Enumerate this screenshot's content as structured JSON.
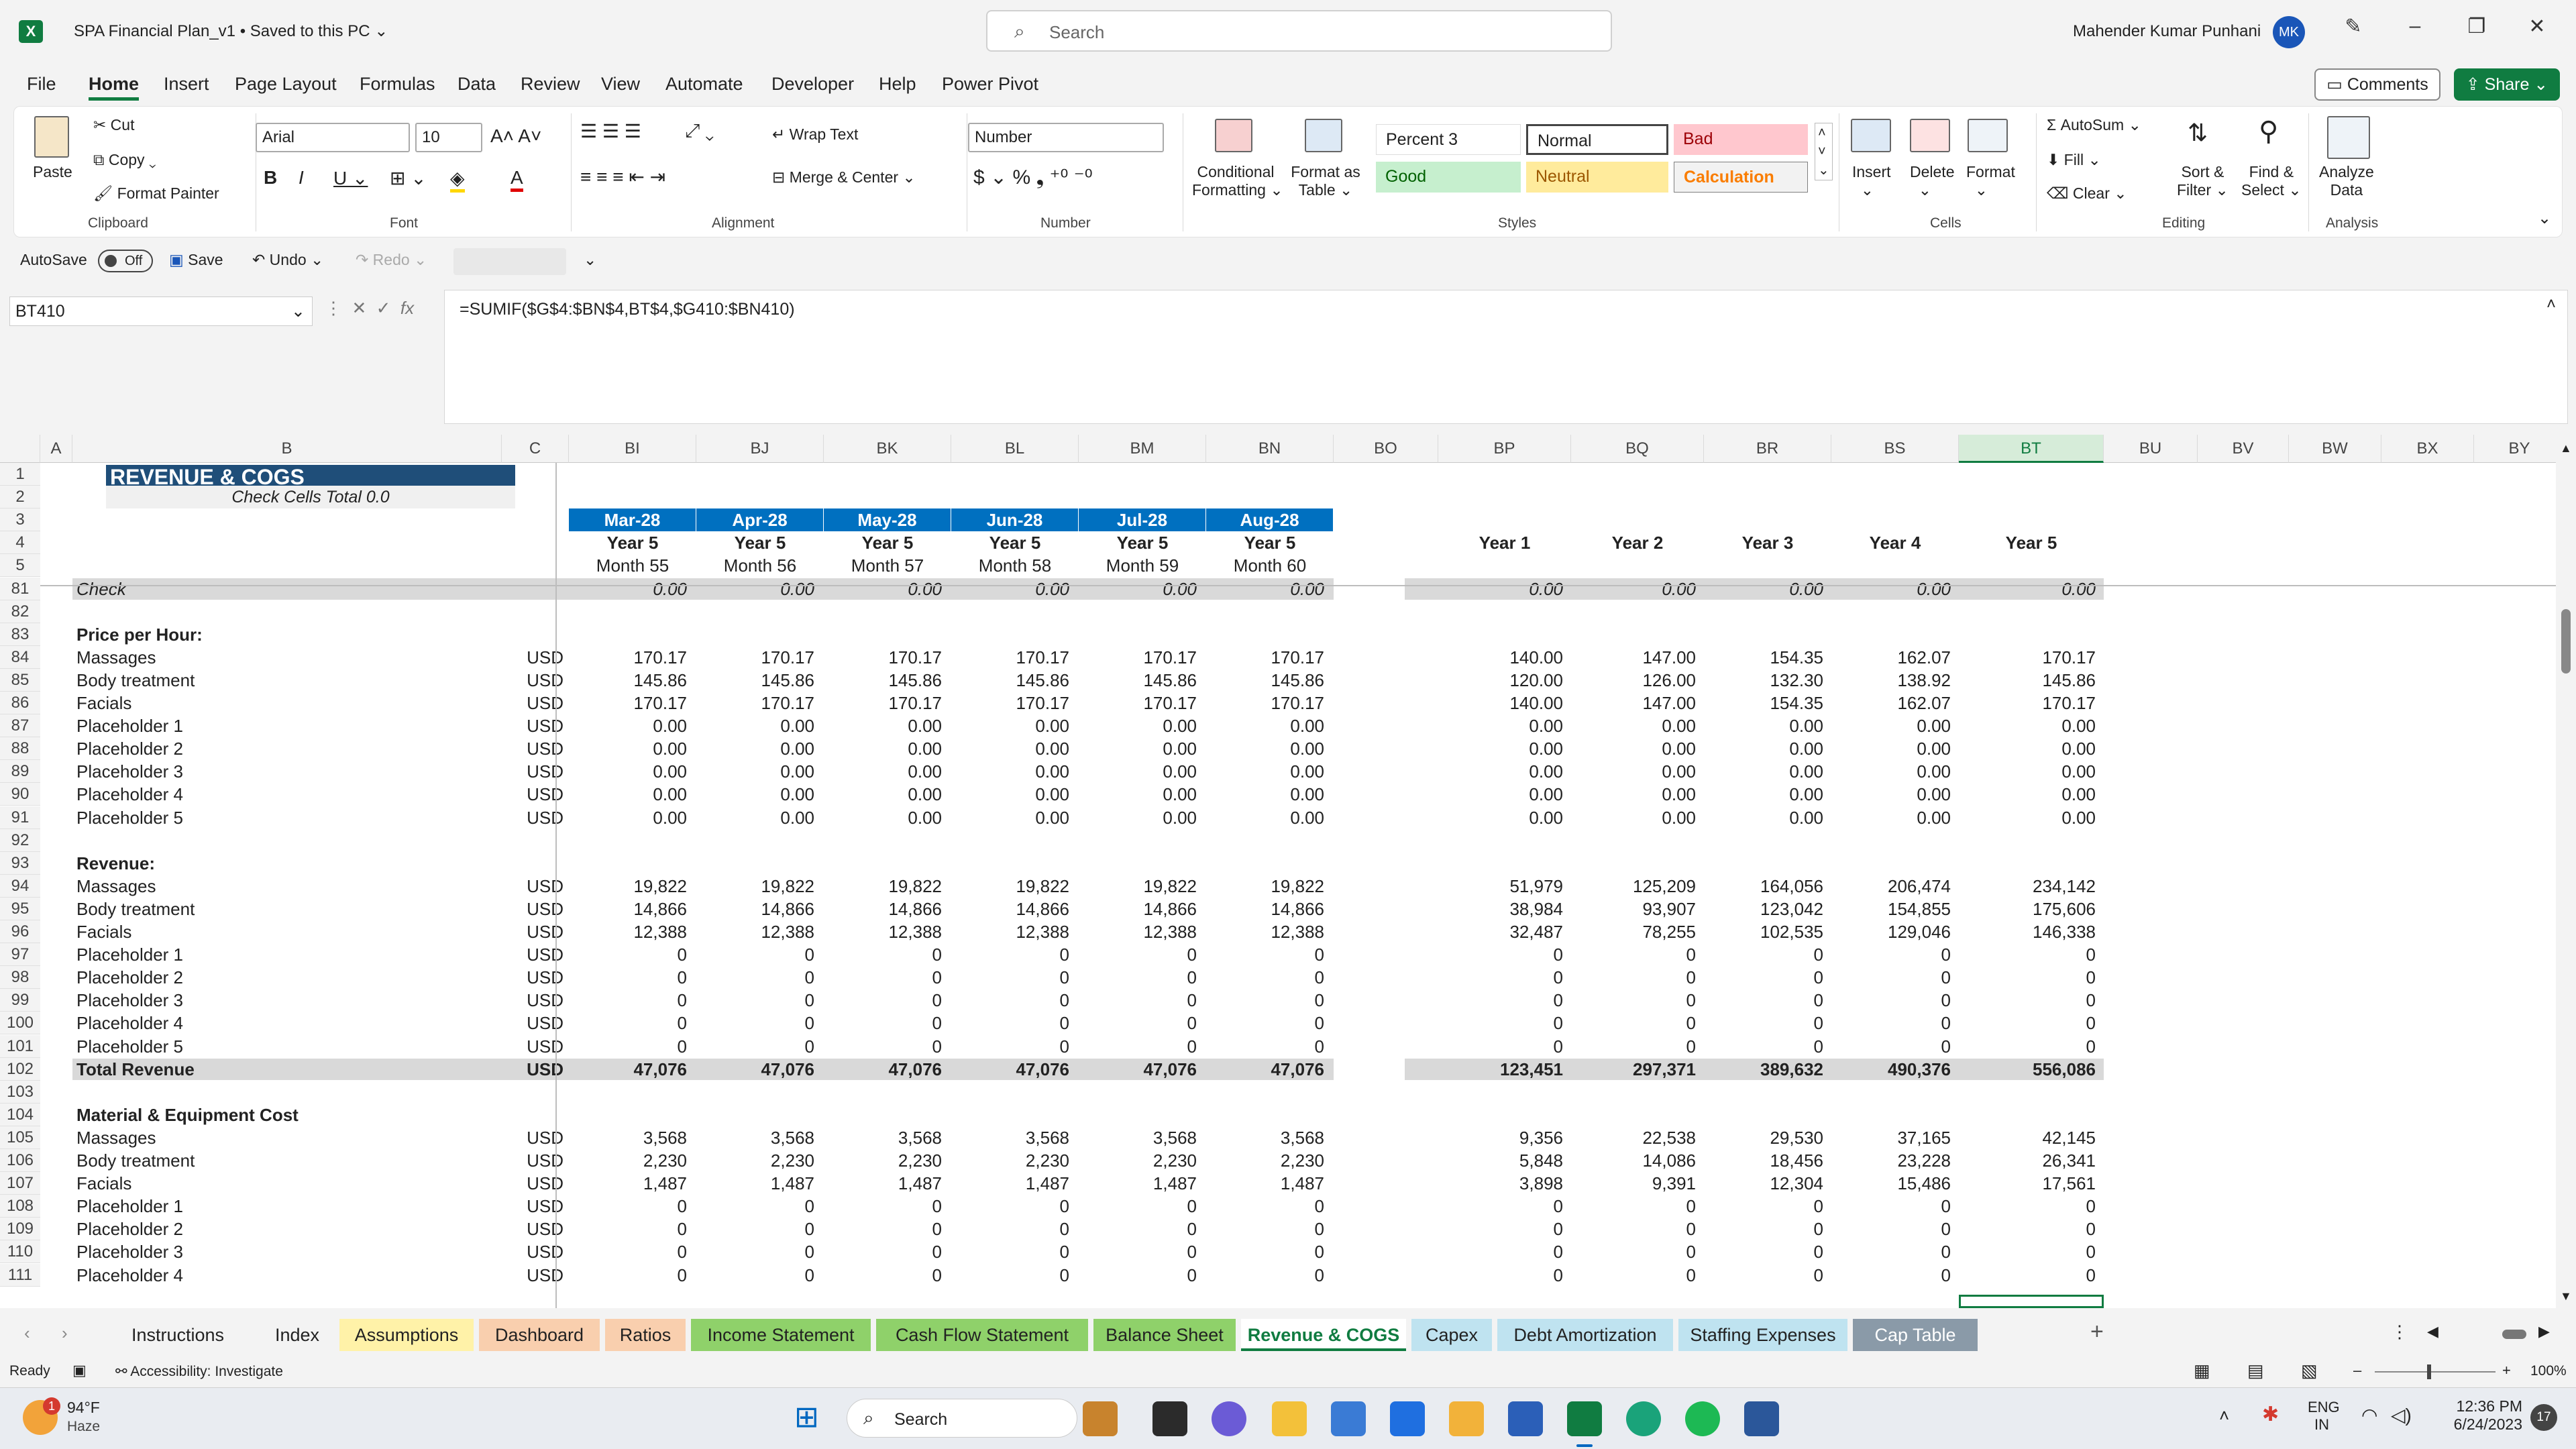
{
  "title": {
    "app_letter": "X",
    "document": "SPA Financial Plan_v1 • Saved to this PC",
    "search_placeholder": "Search",
    "user_name": "Mahender Kumar Punhani",
    "user_initials": "MK"
  },
  "menu": [
    "File",
    "Home",
    "Insert",
    "Page Layout",
    "Formulas",
    "Data",
    "Review",
    "View",
    "Automate",
    "Developer",
    "Help",
    "Power Pivot"
  ],
  "menu_buttons": {
    "comments": "Comments",
    "share": "Share"
  },
  "ribbon": {
    "clipboard": {
      "paste": "Paste",
      "cut": "Cut",
      "copy": "Copy",
      "format_painter": "Format Painter",
      "group": "Clipboard"
    },
    "font": {
      "name": "Arial",
      "size": "10",
      "group": "Font"
    },
    "alignment": {
      "wrap": "Wrap Text",
      "merge": "Merge & Center",
      "group": "Alignment"
    },
    "number": {
      "format": "Number",
      "group": "Number"
    },
    "styles": {
      "conditional": "Conditional",
      "conditional2": "Formatting",
      "format_as": "Format as",
      "format_as2": "Table",
      "items": [
        "Percent 3",
        "Normal",
        "Bad",
        "Good",
        "Neutral",
        "Calculation"
      ],
      "group": "Styles"
    },
    "cells": {
      "insert": "Insert",
      "delete": "Delete",
      "format": "Format",
      "group": "Cells"
    },
    "editing": {
      "autosum": "AutoSum",
      "fill": "Fill",
      "clear": "Clear",
      "sort": "Sort &",
      "sort2": "Filter",
      "find": "Find &",
      "find2": "Select",
      "group": "Editing"
    },
    "analysis": {
      "analyze": "Analyze",
      "analyze2": "Data",
      "group": "Analysis"
    }
  },
  "qat": {
    "autosave": "AutoSave",
    "autosave_state": "Off",
    "save": "Save",
    "undo": "Undo",
    "redo": "Redo"
  },
  "formula_bar": {
    "name_box": "BT410",
    "fx": "fx",
    "formula": "=SUMIF($G$4:$BN$4,BT$4,$G410:$BN410)"
  },
  "columns": [
    "A",
    "B",
    "C",
    "BI",
    "BJ",
    "BK",
    "BL",
    "BM",
    "BN",
    "BO",
    "BP",
    "BQ",
    "BR",
    "BS",
    "BT",
    "BU",
    "BV",
    "BW",
    "BX",
    "BY"
  ],
  "sheet": {
    "title": "REVENUE & COGS",
    "check_total": "Check Cells Total 0.0",
    "months": [
      "Mar-28",
      "Apr-28",
      "May-28",
      "Jun-28",
      "Jul-28",
      "Aug-28"
    ],
    "month_years": [
      "Year 5",
      "Year 5",
      "Year 5",
      "Year 5",
      "Year 5",
      "Year 5"
    ],
    "month_nums": [
      "Month 55",
      "Month 56",
      "Month 57",
      "Month 58",
      "Month 59",
      "Month 60"
    ],
    "year_headers": [
      "Year 1",
      "Year 2",
      "Year 3",
      "Year 4",
      "Year 5"
    ],
    "rows": [
      {
        "r": "1"
      },
      {
        "r": "2"
      },
      {
        "r": "3"
      },
      {
        "r": "4"
      },
      {
        "r": "5"
      },
      {
        "r": "81",
        "label": "Check",
        "style": "check",
        "m": [
          "0.00",
          "0.00",
          "0.00",
          "0.00",
          "0.00",
          "0.00"
        ],
        "y": [
          "0.00",
          "0.00",
          "0.00",
          "0.00",
          "0.00"
        ]
      },
      {
        "r": "82"
      },
      {
        "r": "83",
        "label": "Price per Hour:",
        "style": "header"
      },
      {
        "r": "84",
        "label": "Massages",
        "unit": "USD",
        "m": [
          "170.17",
          "170.17",
          "170.17",
          "170.17",
          "170.17",
          "170.17"
        ],
        "y": [
          "140.00",
          "147.00",
          "154.35",
          "162.07",
          "170.17"
        ]
      },
      {
        "r": "85",
        "label": "Body treatment",
        "unit": "USD",
        "m": [
          "145.86",
          "145.86",
          "145.86",
          "145.86",
          "145.86",
          "145.86"
        ],
        "y": [
          "120.00",
          "126.00",
          "132.30",
          "138.92",
          "145.86"
        ]
      },
      {
        "r": "86",
        "label": "Facials",
        "unit": "USD",
        "m": [
          "170.17",
          "170.17",
          "170.17",
          "170.17",
          "170.17",
          "170.17"
        ],
        "y": [
          "140.00",
          "147.00",
          "154.35",
          "162.07",
          "170.17"
        ]
      },
      {
        "r": "87",
        "label": "Placeholder 1",
        "unit": "USD",
        "m": [
          "0.00",
          "0.00",
          "0.00",
          "0.00",
          "0.00",
          "0.00"
        ],
        "y": [
          "0.00",
          "0.00",
          "0.00",
          "0.00",
          "0.00"
        ]
      },
      {
        "r": "88",
        "label": "Placeholder 2",
        "unit": "USD",
        "m": [
          "0.00",
          "0.00",
          "0.00",
          "0.00",
          "0.00",
          "0.00"
        ],
        "y": [
          "0.00",
          "0.00",
          "0.00",
          "0.00",
          "0.00"
        ]
      },
      {
        "r": "89",
        "label": "Placeholder 3",
        "unit": "USD",
        "m": [
          "0.00",
          "0.00",
          "0.00",
          "0.00",
          "0.00",
          "0.00"
        ],
        "y": [
          "0.00",
          "0.00",
          "0.00",
          "0.00",
          "0.00"
        ]
      },
      {
        "r": "90",
        "label": "Placeholder 4",
        "unit": "USD",
        "m": [
          "0.00",
          "0.00",
          "0.00",
          "0.00",
          "0.00",
          "0.00"
        ],
        "y": [
          "0.00",
          "0.00",
          "0.00",
          "0.00",
          "0.00"
        ]
      },
      {
        "r": "91",
        "label": "Placeholder 5",
        "unit": "USD",
        "m": [
          "0.00",
          "0.00",
          "0.00",
          "0.00",
          "0.00",
          "0.00"
        ],
        "y": [
          "0.00",
          "0.00",
          "0.00",
          "0.00",
          "0.00"
        ]
      },
      {
        "r": "92"
      },
      {
        "r": "93",
        "label": "Revenue:",
        "style": "header"
      },
      {
        "r": "94",
        "label": "Massages",
        "unit": "USD",
        "m": [
          "19,822",
          "19,822",
          "19,822",
          "19,822",
          "19,822",
          "19,822"
        ],
        "y": [
          "51,979",
          "125,209",
          "164,056",
          "206,474",
          "234,142"
        ]
      },
      {
        "r": "95",
        "label": "Body treatment",
        "unit": "USD",
        "m": [
          "14,866",
          "14,866",
          "14,866",
          "14,866",
          "14,866",
          "14,866"
        ],
        "y": [
          "38,984",
          "93,907",
          "123,042",
          "154,855",
          "175,606"
        ]
      },
      {
        "r": "96",
        "label": "Facials",
        "unit": "USD",
        "m": [
          "12,388",
          "12,388",
          "12,388",
          "12,388",
          "12,388",
          "12,388"
        ],
        "y": [
          "32,487",
          "78,255",
          "102,535",
          "129,046",
          "146,338"
        ]
      },
      {
        "r": "97",
        "label": "Placeholder 1",
        "unit": "USD",
        "m": [
          "0",
          "0",
          "0",
          "0",
          "0",
          "0"
        ],
        "y": [
          "0",
          "0",
          "0",
          "0",
          "0"
        ]
      },
      {
        "r": "98",
        "label": "Placeholder 2",
        "unit": "USD",
        "m": [
          "0",
          "0",
          "0",
          "0",
          "0",
          "0"
        ],
        "y": [
          "0",
          "0",
          "0",
          "0",
          "0"
        ]
      },
      {
        "r": "99",
        "label": "Placeholder 3",
        "unit": "USD",
        "m": [
          "0",
          "0",
          "0",
          "0",
          "0",
          "0"
        ],
        "y": [
          "0",
          "0",
          "0",
          "0",
          "0"
        ]
      },
      {
        "r": "100",
        "label": "Placeholder 4",
        "unit": "USD",
        "m": [
          "0",
          "0",
          "0",
          "0",
          "0",
          "0"
        ],
        "y": [
          "0",
          "0",
          "0",
          "0",
          "0"
        ]
      },
      {
        "r": "101",
        "label": "Placeholder 5",
        "unit": "USD",
        "m": [
          "0",
          "0",
          "0",
          "0",
          "0",
          "0"
        ],
        "y": [
          "0",
          "0",
          "0",
          "0",
          "0"
        ]
      },
      {
        "r": "102",
        "label": "Total Revenue",
        "unit": "USD",
        "style": "total",
        "m": [
          "47,076",
          "47,076",
          "47,076",
          "47,076",
          "47,076",
          "47,076"
        ],
        "y": [
          "123,451",
          "297,371",
          "389,632",
          "490,376",
          "556,086"
        ]
      },
      {
        "r": "103"
      },
      {
        "r": "104",
        "label": "Material & Equipment Cost",
        "style": "header"
      },
      {
        "r": "105",
        "label": "Massages",
        "unit": "USD",
        "m": [
          "3,568",
          "3,568",
          "3,568",
          "3,568",
          "3,568",
          "3,568"
        ],
        "y": [
          "9,356",
          "22,538",
          "29,530",
          "37,165",
          "42,145"
        ]
      },
      {
        "r": "106",
        "label": "Body treatment",
        "unit": "USD",
        "m": [
          "2,230",
          "2,230",
          "2,230",
          "2,230",
          "2,230",
          "2,230"
        ],
        "y": [
          "5,848",
          "14,086",
          "18,456",
          "23,228",
          "26,341"
        ]
      },
      {
        "r": "107",
        "label": "Facials",
        "unit": "USD",
        "m": [
          "1,487",
          "1,487",
          "1,487",
          "1,487",
          "1,487",
          "1,487"
        ],
        "y": [
          "3,898",
          "9,391",
          "12,304",
          "15,486",
          "17,561"
        ]
      },
      {
        "r": "108",
        "label": "Placeholder 1",
        "unit": "USD",
        "m": [
          "0",
          "0",
          "0",
          "0",
          "0",
          "0"
        ],
        "y": [
          "0",
          "0",
          "0",
          "0",
          "0"
        ]
      },
      {
        "r": "109",
        "label": "Placeholder 2",
        "unit": "USD",
        "m": [
          "0",
          "0",
          "0",
          "0",
          "0",
          "0"
        ],
        "y": [
          "0",
          "0",
          "0",
          "0",
          "0"
        ]
      },
      {
        "r": "110",
        "label": "Placeholder 3",
        "unit": "USD",
        "m": [
          "0",
          "0",
          "0",
          "0",
          "0",
          "0"
        ],
        "y": [
          "0",
          "0",
          "0",
          "0",
          "0"
        ]
      },
      {
        "r": "111",
        "label": "Placeholder 4",
        "unit": "USD",
        "m": [
          "0",
          "0",
          "0",
          "0",
          "0",
          "0"
        ],
        "y": [
          "0",
          "0",
          "0",
          "0",
          "0"
        ]
      }
    ]
  },
  "tabs": [
    {
      "label": "Instructions",
      "color": "#f3f3f3"
    },
    {
      "label": "Index",
      "color": "#f3f3f3"
    },
    {
      "label": "Assumptions",
      "color": "#fff2a8"
    },
    {
      "label": "Dashboard",
      "color": "#f9cfae"
    },
    {
      "label": "Ratios",
      "color": "#f9cfae"
    },
    {
      "label": "Income Statement",
      "color": "#8fd16a"
    },
    {
      "label": "Cash Flow Statement",
      "color": "#8fd16a"
    },
    {
      "label": "Balance Sheet",
      "color": "#8fd16a"
    },
    {
      "label": "Revenue & COGS",
      "color": "#ffffff",
      "active": true
    },
    {
      "label": "Capex",
      "color": "#bfe3f0"
    },
    {
      "label": "Debt Amortization",
      "color": "#bfe3f0"
    },
    {
      "label": "Staffing Expenses",
      "color": "#bfe3f0"
    },
    {
      "label": "Cap Table",
      "color": "#8a9aa8"
    }
  ],
  "status": {
    "ready": "Ready",
    "accessibility": "Accessibility: Investigate",
    "zoom": "100%"
  },
  "taskbar": {
    "temp": "94°F",
    "weather": "Haze",
    "weather_badge": "1",
    "search": "Search",
    "lang1": "ENG",
    "lang2": "IN",
    "time": "12:36 PM",
    "date": "6/24/2023",
    "notif": "17"
  },
  "colors": {
    "accent": "#107c41",
    "header_blue": "#1f4e79",
    "month_blue": "#0070c0",
    "total_gray": "#d9d9d9"
  }
}
